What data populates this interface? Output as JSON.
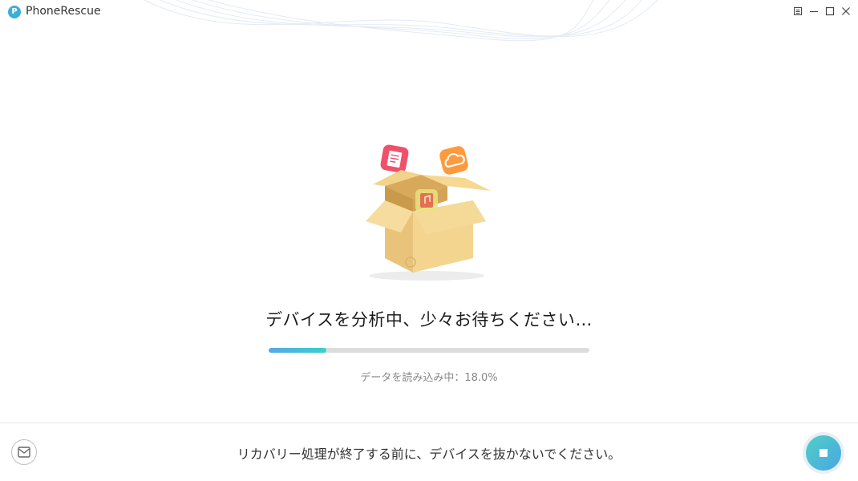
{
  "app": {
    "title": "PhoneRescue",
    "logo_letter": "P"
  },
  "window_controls": [
    "menu-icon",
    "minimize-icon",
    "maximize-icon",
    "close-icon"
  ],
  "hero": {
    "icons": [
      "box-icon",
      "notes-app-icon",
      "cloud-app-icon",
      "music-app-icon"
    ]
  },
  "status": {
    "title": "デバイスを分析中、少々お待ちください…",
    "detail": "データを読み込み中：18.0%",
    "progress": 0.18
  },
  "footer": {
    "note": "リカバリー処理が終了する前に、デバイスを抜かないでください。",
    "mail_icon": "mail-icon",
    "stop_icon": "stop-icon"
  },
  "colors": {
    "accent": "#3aaed8",
    "progress_start": "#56a8ea",
    "progress_end": "#39d0c8",
    "box": "#f0cf86"
  }
}
